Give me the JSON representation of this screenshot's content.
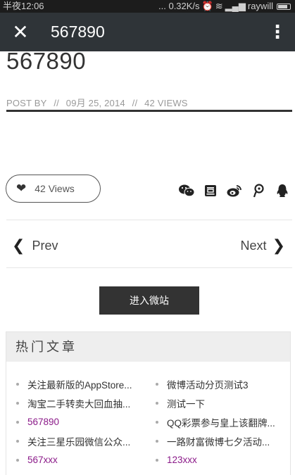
{
  "status_bar": {
    "time": "半夜12:06",
    "network_speed": "... 0.32K/s",
    "carrier": "raywill"
  },
  "app_bar": {
    "title": "567890"
  },
  "post": {
    "title": "567890",
    "meta": {
      "post_by": "POST BY",
      "separator": "//",
      "date": "09月 25, 2014",
      "views": "42 VIEWS"
    },
    "views_pill": "42 Views"
  },
  "share_icons": [
    "wechat-icon",
    "douban-icon",
    "weibo-icon",
    "tencent-weibo-icon",
    "qq-icon"
  ],
  "nav": {
    "prev": "Prev",
    "next": "Next"
  },
  "enter_button": "进入微站",
  "hot_articles": {
    "heading": "热门文章",
    "items": [
      {
        "label": "关注最新版的AppStore...",
        "visited": false
      },
      {
        "label": "微博活动分页测试3",
        "visited": false
      },
      {
        "label": "淘宝二手转卖大回血抽...",
        "visited": false
      },
      {
        "label": "测试一下",
        "visited": false
      },
      {
        "label": "567890",
        "visited": true
      },
      {
        "label": "QQ彩票参与皇上该翻牌...",
        "visited": false
      },
      {
        "label": "关注三星乐园微信公众...",
        "visited": false
      },
      {
        "label": "一路财富微博七夕活动...",
        "visited": false
      },
      {
        "label": "567xxx",
        "visited": true
      },
      {
        "label": "123xxx",
        "visited": true
      }
    ]
  },
  "colors": {
    "app_bar": "#2f3438",
    "visited_link": "#8b1a89",
    "button": "#333333"
  }
}
